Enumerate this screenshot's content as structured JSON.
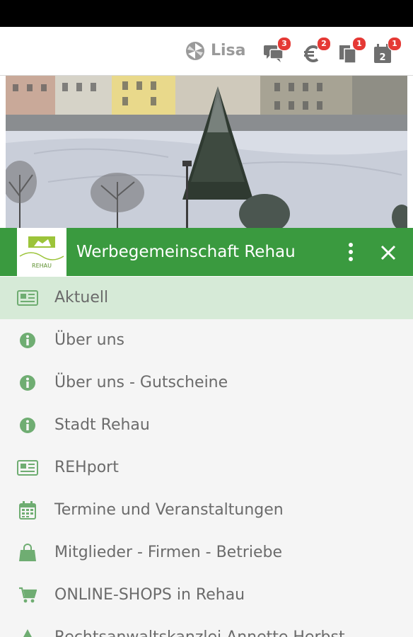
{
  "topbar": {
    "username": "Lisa",
    "icons": [
      {
        "name": "chat-icon",
        "badge": "3"
      },
      {
        "name": "euro-icon",
        "badge": "2"
      },
      {
        "name": "documents-icon",
        "badge": "1"
      },
      {
        "name": "calendar-icon",
        "badge": "1"
      }
    ]
  },
  "header": {
    "title": "Werbegemeinschaft Rehau",
    "logo_text": "REHAU"
  },
  "colors": {
    "accent": "#3a9a3f",
    "active_row": "#d6ead7",
    "badge": "#e53935"
  },
  "menu": [
    {
      "label": "Aktuell",
      "icon": "newspaper-icon",
      "active": true
    },
    {
      "label": "Über uns",
      "icon": "info-icon"
    },
    {
      "label": "Über uns - Gutscheine",
      "icon": "info-icon"
    },
    {
      "label": "Stadt Rehau",
      "icon": "info-icon"
    },
    {
      "label": "REHport",
      "icon": "newspaper-icon"
    },
    {
      "label": "Termine und Veranstaltungen",
      "icon": "calendar-icon"
    },
    {
      "label": "Mitglieder - Firmen - Betriebe",
      "icon": "shopping-bag-icon"
    },
    {
      "label": "ONLINE-SHOPS in Rehau",
      "icon": "cart-icon"
    },
    {
      "label": "Rechtsanwaltskanzlei Annette Herbst",
      "icon": "scale-icon"
    }
  ]
}
